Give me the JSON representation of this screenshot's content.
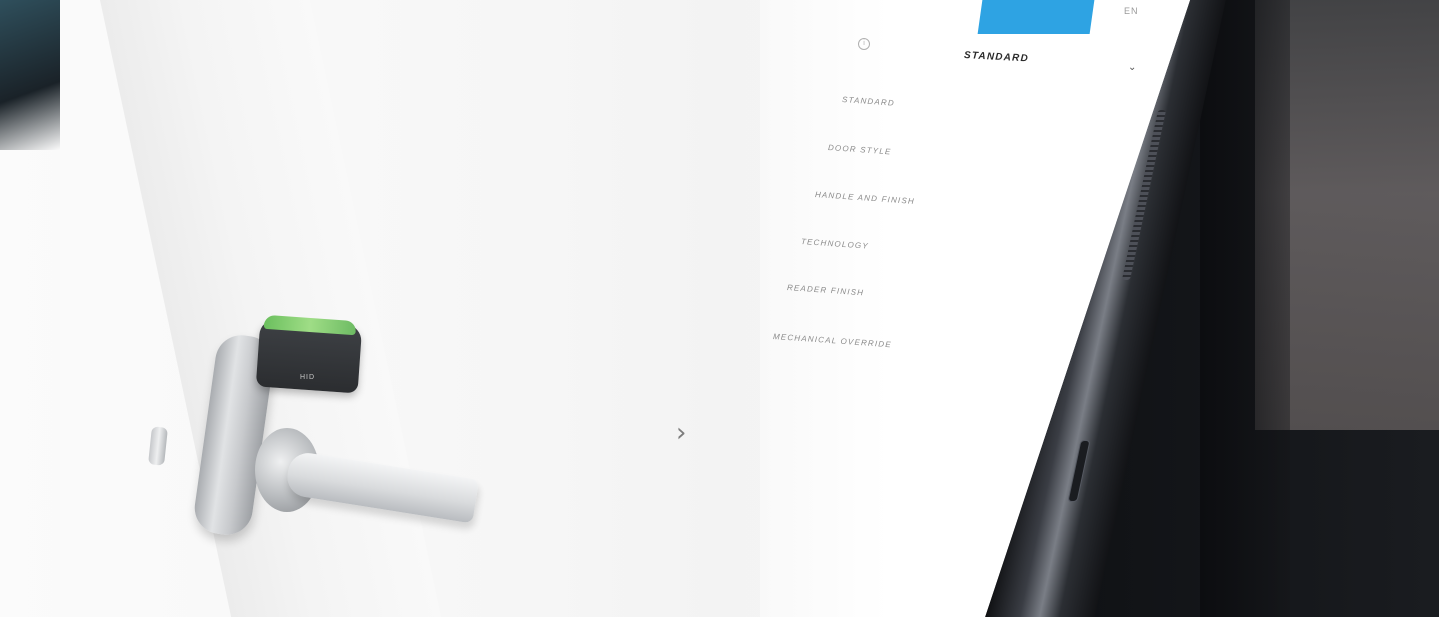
{
  "top_button": {
    "label": ""
  },
  "language": {
    "label": "EN"
  },
  "selector": {
    "selected": "STANDARD"
  },
  "menu": {
    "items": [
      {
        "label": "STANDARD"
      },
      {
        "label": "DOOR STYLE"
      },
      {
        "label": "HANDLE AND FINISH"
      },
      {
        "label": "TECHNOLOGY"
      },
      {
        "label": "READER FINISH"
      },
      {
        "label": "MECHANICAL OVERRIDE"
      }
    ]
  },
  "product": {
    "logo_text": "HID"
  },
  "colors": {
    "accent_blue": "#2ea3e3",
    "reader_led_green": "#9fdd86"
  },
  "icons": {
    "info": "info-icon",
    "dropdown": "chevron-down-icon",
    "next": "chevron-right-icon"
  }
}
